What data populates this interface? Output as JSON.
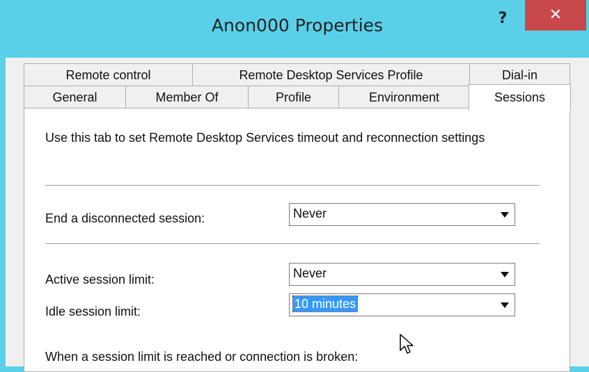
{
  "window": {
    "title": "Anon000 Properties",
    "help_label": "?",
    "close_label": "✕"
  },
  "tabs": {
    "row_top": [
      "Remote control",
      "Remote Desktop Services Profile",
      "Dial-in"
    ],
    "row_bottom": [
      "General",
      "Member Of",
      "Profile",
      "Environment",
      "Sessions"
    ],
    "active": "Sessions"
  },
  "sessions": {
    "description": "Use this tab to set Remote Desktop Services timeout and reconnection settings",
    "end_disconnected_label": "End a disconnected session:",
    "end_disconnected_value": "Never",
    "active_limit_label": "Active session limit:",
    "active_limit_value": "Never",
    "idle_limit_label": "Idle session limit:",
    "idle_limit_value": "10 minutes",
    "limit_reached_label": "When a session limit is reached or connection is broken:"
  },
  "colors": {
    "titlebar": "#5ad0e8",
    "close_button": "#c8474a",
    "selection": "#3399ff"
  }
}
